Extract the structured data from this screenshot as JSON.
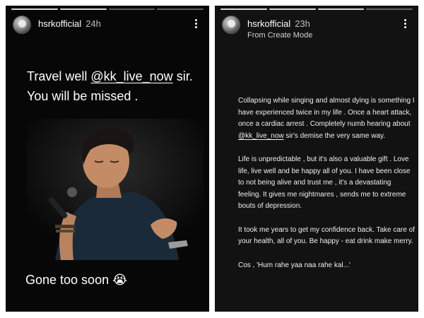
{
  "left_story": {
    "username": "hsrkofficial",
    "time": "24h",
    "caption_top_pre": "Travel well ",
    "caption_mention": "@kk_live_now",
    "caption_top_post": " sir. You will be missed .",
    "caption_bottom": "Gone too soon 😭",
    "progress_segments": 4,
    "progress_done": 2
  },
  "right_story": {
    "username": "hsrkofficial",
    "time": "23h",
    "subtitle": "From Create Mode",
    "p1_pre": "Collapsing while singing and almost dying is something I have experienced twice in my life . Once a heart attack, once a cardiac arrest . Completely numb hearing about ",
    "p1_mention": "@kk_live_now",
    "p1_post": " sir's demise the very same way.",
    "p2": "Life is unpredictable , but it's also a valuable gift . Love life, live well and be happy all of you. I have been close to not being alive and trust me , it's a devastating feeling. It gives me nightmares , sends me to extreme bouts of depression.",
    "p3": "It took me years to get my confidence back. Take care of your health, all of you. Be happy - eat drink make merry.",
    "p4": "Cos , 'Hum rahe yaa naa rahe kal...'",
    "progress_segments": 4,
    "progress_done": 3
  },
  "icons": {
    "avatar": "profile-photo",
    "more": "more-vertical-icon"
  },
  "colors": {
    "story_bg": "#070707",
    "story_text_bg": "#121212",
    "text": "#ffffff"
  }
}
